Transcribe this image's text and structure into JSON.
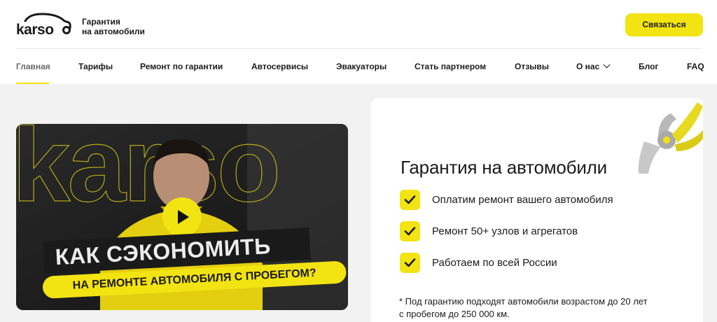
{
  "header": {
    "logo_text": "karso",
    "tagline_line1": "Гарантия",
    "tagline_line2": "на автомобили",
    "contact_label": "Связаться"
  },
  "nav": {
    "items": [
      {
        "label": "Главная",
        "active": true
      },
      {
        "label": "Тарифы"
      },
      {
        "label": "Ремонт по гарантии"
      },
      {
        "label": "Автосервисы"
      },
      {
        "label": "Эвакуаторы"
      },
      {
        "label": "Стать партнером"
      },
      {
        "label": "Отзывы"
      },
      {
        "label": "О нас",
        "has_dropdown": true
      },
      {
        "label": "Блог"
      },
      {
        "label": "FAQ"
      }
    ]
  },
  "video": {
    "overlay_line1": "КАК СЭКОНОМИТЬ",
    "overlay_line2": "НА РЕМОНТЕ АВТОМОБИЛЯ С ПРОБЕГОМ?",
    "background_brand_text": "karso",
    "play_icon": "play-icon"
  },
  "info": {
    "title": "Гарантия на автомобили",
    "features": [
      "Оплатим ремонт вашего автомобиля",
      "Ремонт 50+ узлов и агрегатов",
      "Работаем по всей России"
    ],
    "footnote_line1": "* Под гарантию подходят автомобили возрастом до 20 лет",
    "footnote_line2": "с пробегом до 250 000 км."
  },
  "colors": {
    "accent": "#f2e312",
    "text": "#1b1b1b",
    "background": "#f2f2f2",
    "card": "#ffffff"
  }
}
